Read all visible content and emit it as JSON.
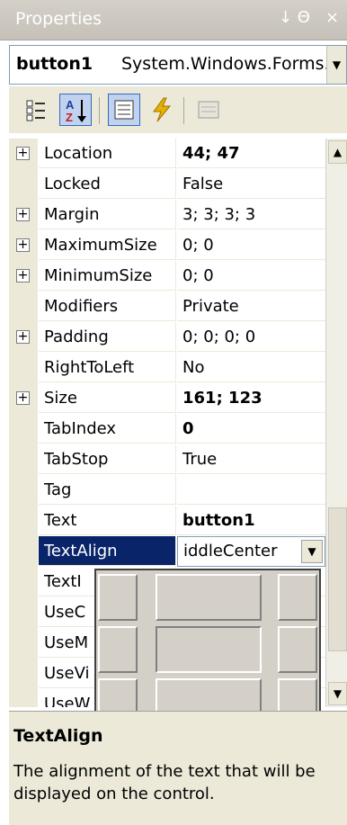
{
  "window": {
    "title": "Properties",
    "pin_glyph": "↓ Θ",
    "close_glyph": "×"
  },
  "selector": {
    "object_name": "button1",
    "object_type": "System.Windows.Forms.",
    "dropdown_glyph": "▼"
  },
  "toolbar": {
    "buttons": [
      {
        "name": "categorized-icon",
        "active": false
      },
      {
        "name": "alphabetical-icon",
        "active": true
      },
      {
        "name": "properties-icon",
        "active": true
      },
      {
        "name": "events-icon",
        "active": false
      },
      {
        "name": "property-pages-icon",
        "active": false
      }
    ]
  },
  "grid": {
    "rows": [
      {
        "name": "Location",
        "value": "44; 47",
        "expandable": true,
        "bold": true
      },
      {
        "name": "Locked",
        "value": "False",
        "expandable": false,
        "bold": false
      },
      {
        "name": "Margin",
        "value": "3; 3; 3; 3",
        "expandable": true,
        "bold": false
      },
      {
        "name": "MaximumSize",
        "value": "0; 0",
        "expandable": true,
        "bold": false
      },
      {
        "name": "MinimumSize",
        "value": "0; 0",
        "expandable": true,
        "bold": false
      },
      {
        "name": "Modifiers",
        "value": "Private",
        "expandable": false,
        "bold": false
      },
      {
        "name": "Padding",
        "value": "0; 0; 0; 0",
        "expandable": true,
        "bold": false
      },
      {
        "name": "RightToLeft",
        "value": "No",
        "expandable": false,
        "bold": false
      },
      {
        "name": "Size",
        "value": "161; 123",
        "expandable": true,
        "bold": true
      },
      {
        "name": "TabIndex",
        "value": "0",
        "expandable": false,
        "bold": true
      },
      {
        "name": "TabStop",
        "value": "True",
        "expandable": false,
        "bold": false
      },
      {
        "name": "Tag",
        "value": "",
        "expandable": false,
        "bold": false
      },
      {
        "name": "Text",
        "value": "button1",
        "expandable": false,
        "bold": true
      },
      {
        "name": "TextAlign",
        "value": "iddleCenter",
        "expandable": false,
        "bold": false,
        "selected": true
      },
      {
        "name": "TextI",
        "value": "",
        "expandable": false,
        "bold": false
      },
      {
        "name": "UseC",
        "value": "",
        "expandable": false,
        "bold": false
      },
      {
        "name": "UseM",
        "value": "",
        "expandable": false,
        "bold": false
      },
      {
        "name": "UseVi",
        "value": "",
        "expandable": false,
        "bold": false
      },
      {
        "name": "UseW",
        "value": "",
        "expandable": false,
        "bold": false
      }
    ],
    "expand_glyph": "+",
    "dropdown_glyph": "▼"
  },
  "scrollbar": {
    "up_glyph": "▲",
    "down_glyph": "▼"
  },
  "align_picker": {
    "options": [
      "TopLeft",
      "TopCenter",
      "TopRight",
      "MiddleLeft",
      "MiddleCenter",
      "MiddleRight",
      "BottomLeft",
      "BottomCenter",
      "BottomRight"
    ],
    "selected": "MiddleCenter"
  },
  "description": {
    "title": "TextAlign",
    "text": "The alignment of the text that will be displayed on the control."
  }
}
